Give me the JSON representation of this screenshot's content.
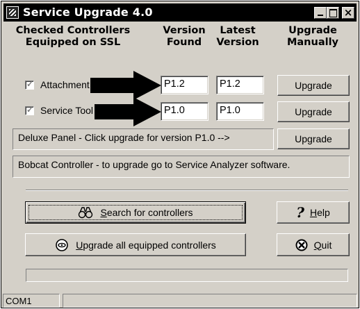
{
  "window": {
    "title": "Service Upgrade 4.0",
    "close_glyph": "×"
  },
  "headers": {
    "controllers": [
      "Checked Controllers",
      "Equipped on SSL"
    ],
    "version_found": [
      "Version",
      "Found"
    ],
    "latest_version": [
      "Latest",
      "Version"
    ],
    "upgrade_manually": [
      "Upgrade",
      "Manually"
    ]
  },
  "rows": [
    {
      "checked": true,
      "label": "Attachment",
      "found": "P1.2",
      "latest": "P1.2",
      "button": "Upgrade"
    },
    {
      "checked": true,
      "label": "Service Tool",
      "found": "P1.0",
      "latest": "P1.0",
      "button": "Upgrade"
    }
  ],
  "deluxe_panel": {
    "text": "Deluxe Panel - Click upgrade for version P1.0  -->",
    "button": "Upgrade"
  },
  "bobcat_panel": {
    "text": "Bobcat Controller - to upgrade go to Service Analyzer software."
  },
  "actions": {
    "search": {
      "mnemonic": "S",
      "rest": "earch for controllers",
      "icon": "binoculars-icon"
    },
    "upgrade_all": {
      "mnemonic": "U",
      "rest": "pgrade all equipped controllers",
      "icon": "disk-icon"
    },
    "help": {
      "mnemonic": "H",
      "rest": "elp",
      "glyph": "?",
      "icon": "question-icon"
    },
    "quit": {
      "mnemonic": "Q",
      "rest": "uit",
      "icon": "quit-icon"
    }
  },
  "progress": {
    "value": 0
  },
  "status": {
    "port": "COM1"
  },
  "check_glyph": "✓"
}
